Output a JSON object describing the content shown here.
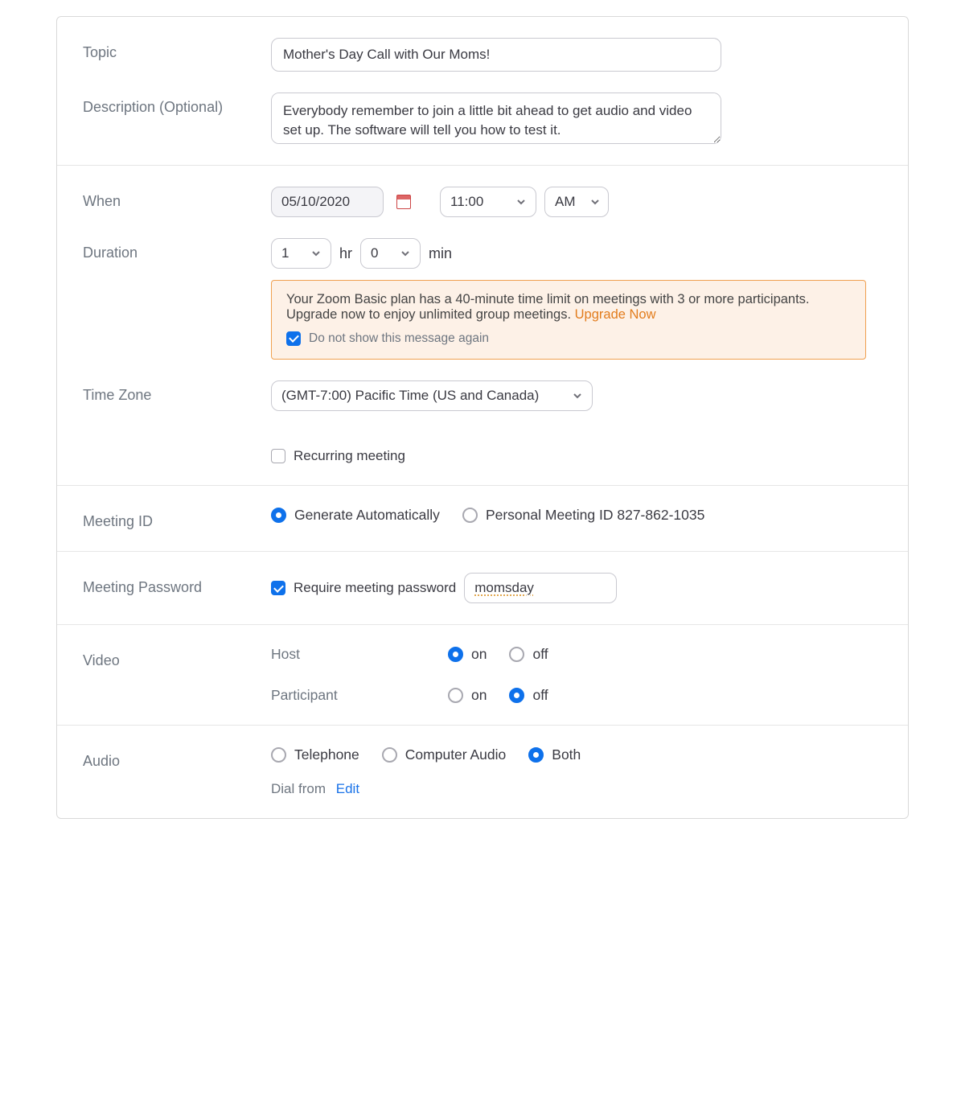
{
  "labels": {
    "topic": "Topic",
    "description": "Description (Optional)",
    "when": "When",
    "duration": "Duration",
    "timezone": "Time Zone",
    "meeting_id": "Meeting ID",
    "meeting_pw": "Meeting Password",
    "video": "Video",
    "audio": "Audio"
  },
  "topic": {
    "value": "Mother's Day Call with Our Moms!"
  },
  "description": {
    "value": "Everybody remember to join a little bit ahead to get audio and video set up. The software will tell you how to test it."
  },
  "when": {
    "date": "05/10/2020",
    "time": "11:00",
    "ampm": "AM"
  },
  "duration": {
    "hours": "1",
    "hours_unit": "hr",
    "mins": "0",
    "mins_unit": "min"
  },
  "notice": {
    "text": "Your Zoom Basic plan has a 40-minute time limit on meetings with 3 or more participants. Upgrade now to enjoy unlimited group meetings.",
    "link": "Upgrade Now",
    "suppress_label": "Do not show this message again"
  },
  "timezone": {
    "value": "(GMT-7:00) Pacific Time (US and Canada)"
  },
  "recurring_label": "Recurring meeting",
  "meeting_id": {
    "auto_label": "Generate Automatically",
    "pmi_label": "Personal Meeting ID 827-862-1035"
  },
  "meeting_pw": {
    "require_label": "Require meeting password",
    "value": "momsday"
  },
  "video": {
    "host_label": "Host",
    "participant_label": "Participant",
    "on": "on",
    "off": "off"
  },
  "audio": {
    "telephone": "Telephone",
    "computer": "Computer Audio",
    "both": "Both",
    "dial_from": "Dial from",
    "edit": "Edit"
  }
}
